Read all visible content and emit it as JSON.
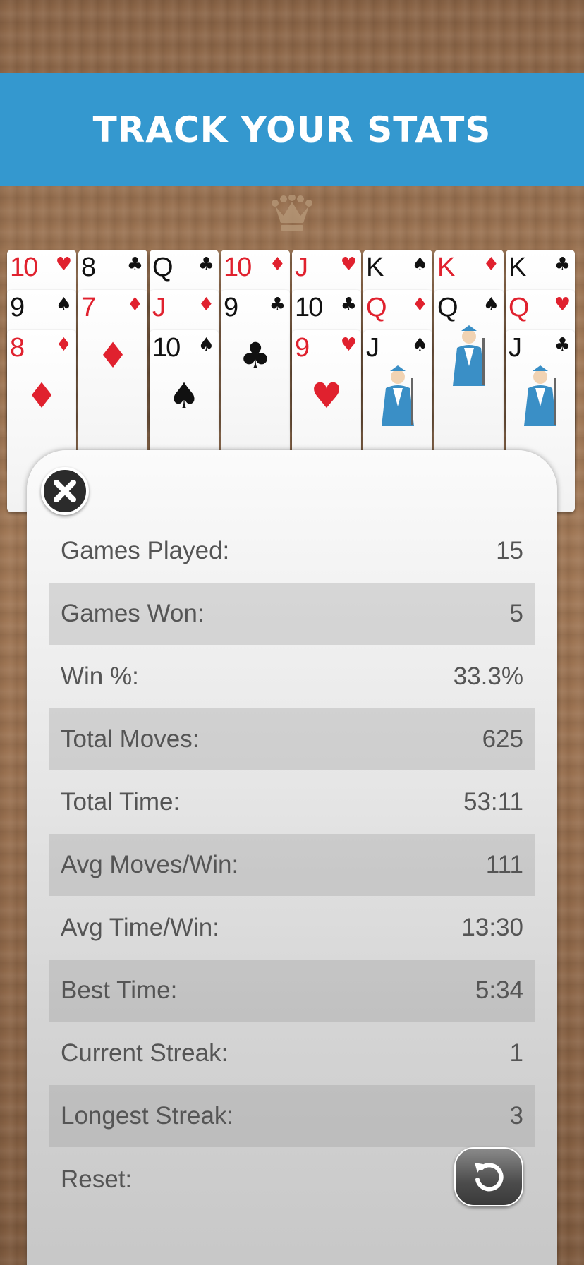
{
  "banner": {
    "title": "TRACK YOUR STATS"
  },
  "icons": {
    "crown": "crown-icon",
    "close": "close-icon",
    "reset": "reset-icon"
  },
  "colors": {
    "banner": "#3498cf",
    "red_suit": "#e0212e",
    "black_suit": "#111111"
  },
  "tableau": [
    [
      {
        "rank": "10",
        "suit": "♥",
        "color": "red"
      },
      {
        "rank": "9",
        "suit": "♠",
        "color": "black"
      },
      {
        "rank": "8",
        "suit": "♦",
        "color": "red"
      }
    ],
    [
      {
        "rank": "8",
        "suit": "♣",
        "color": "black"
      },
      {
        "rank": "7",
        "suit": "♦",
        "color": "red"
      }
    ],
    [
      {
        "rank": "Q",
        "suit": "♣",
        "color": "black"
      },
      {
        "rank": "J",
        "suit": "♦",
        "color": "red"
      },
      {
        "rank": "10",
        "suit": "♠",
        "color": "black"
      }
    ],
    [
      {
        "rank": "10",
        "suit": "♦",
        "color": "red"
      },
      {
        "rank": "9",
        "suit": "♣",
        "color": "black"
      }
    ],
    [
      {
        "rank": "J",
        "suit": "♥",
        "color": "red"
      },
      {
        "rank": "10",
        "suit": "♣",
        "color": "black"
      },
      {
        "rank": "9",
        "suit": "♥",
        "color": "red"
      }
    ],
    [
      {
        "rank": "K",
        "suit": "♠",
        "color": "black"
      },
      {
        "rank": "Q",
        "suit": "♦",
        "color": "red"
      },
      {
        "rank": "J",
        "suit": "♠",
        "color": "black"
      }
    ],
    [
      {
        "rank": "K",
        "suit": "♦",
        "color": "red"
      },
      {
        "rank": "Q",
        "suit": "♠",
        "color": "black"
      }
    ],
    [
      {
        "rank": "K",
        "suit": "♣",
        "color": "black"
      },
      {
        "rank": "Q",
        "suit": "♥",
        "color": "red"
      },
      {
        "rank": "J",
        "suit": "♣",
        "color": "black"
      }
    ]
  ],
  "stats": [
    {
      "label": "Games Played:",
      "value": "15"
    },
    {
      "label": "Games Won:",
      "value": "5"
    },
    {
      "label": "Win %:",
      "value": "33.3%"
    },
    {
      "label": "Total Moves:",
      "value": "625"
    },
    {
      "label": "Total Time:",
      "value": "53:11"
    },
    {
      "label": "Avg Moves/Win:",
      "value": "111"
    },
    {
      "label": "Avg Time/Win:",
      "value": "13:30"
    },
    {
      "label": "Best Time:",
      "value": "5:34"
    },
    {
      "label": "Current Streak:",
      "value": "1"
    },
    {
      "label": "Longest Streak:",
      "value": "3"
    }
  ],
  "reset": {
    "label": "Reset:"
  }
}
